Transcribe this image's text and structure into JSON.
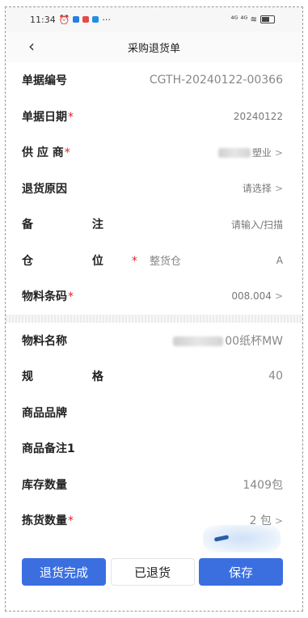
{
  "status_bar": {
    "time": "11:34",
    "more": "···",
    "signal": "⁴ᴳ ⁴ᴳ ≋"
  },
  "nav": {
    "back_icon": "chevron-left-icon",
    "title": "采购退货单"
  },
  "fields": {
    "doc_no": {
      "label": "单据编号",
      "value": "CGTH-20240122-00366"
    },
    "doc_date": {
      "label": "单据日期",
      "required": "*",
      "value": "20240122"
    },
    "supplier": {
      "label": "供 应 商",
      "required": "*",
      "value": "塑业"
    },
    "reason": {
      "label": "退货原因",
      "value": "请选择"
    },
    "remark": {
      "label": "备 注",
      "value": "请输入/扫描"
    },
    "location": {
      "label": "仓 位",
      "required": "*",
      "mid": "整货仓",
      "value": "A"
    },
    "barcode": {
      "label": "物料条码",
      "required": "*",
      "value": "008.004"
    },
    "material_name": {
      "label": "物料名称",
      "value": "00纸杯MW"
    },
    "spec": {
      "label": "规 格",
      "value": "40"
    },
    "brand": {
      "label": "商品品牌",
      "value": ""
    },
    "goods_remark": {
      "label": "商品备注1",
      "value": ""
    },
    "stock_qty": {
      "label": "库存数量",
      "value": "1409包"
    },
    "pick_qty": {
      "label": "拣货数量",
      "required": "*",
      "value": "2 包"
    }
  },
  "chevron": ">",
  "buttons": {
    "complete": "退货完成",
    "returned": "已退货",
    "save": "保存"
  },
  "colors": {
    "primary": "#3b6fe0",
    "required": "#e02020"
  }
}
